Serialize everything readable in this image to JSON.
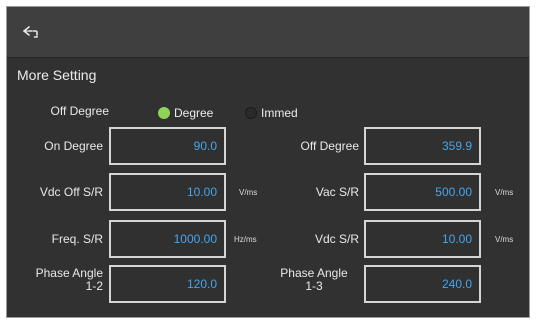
{
  "section": {
    "title": "More Setting"
  },
  "off_mode": {
    "label": "Off Degree",
    "options": [
      {
        "label": "Degree",
        "selected": true
      },
      {
        "label": "Immed",
        "selected": false
      }
    ]
  },
  "fields": {
    "on_degree": {
      "label": "On Degree",
      "value": "90.0"
    },
    "off_degree": {
      "label": "Off Degree",
      "value": "359.9"
    },
    "vdc_off_sr": {
      "label": "Vdc Off S/R",
      "value": "10.00",
      "unit": "V/ms"
    },
    "vac_sr": {
      "label": "Vac S/R",
      "value": "500.00",
      "unit": "V/ms"
    },
    "freq_sr": {
      "label": "Freq. S/R",
      "value": "1000.00",
      "unit": "Hz/ms"
    },
    "vdc_sr": {
      "label": "Vdc S/R",
      "value": "10.00",
      "unit": "V/ms"
    },
    "phase_angle_12": {
      "label_line1": "Phase Angle",
      "label_line2": "1-2",
      "value": "120.0"
    },
    "phase_angle_13": {
      "label_line1": "Phase Angle",
      "label_line2": "1-3",
      "value": "240.0"
    }
  },
  "colors": {
    "accent_value": "#45a5ec",
    "radio_selected": "#8fd35a",
    "background": "#313131"
  },
  "icons": {
    "back": "return-arrow-icon"
  }
}
